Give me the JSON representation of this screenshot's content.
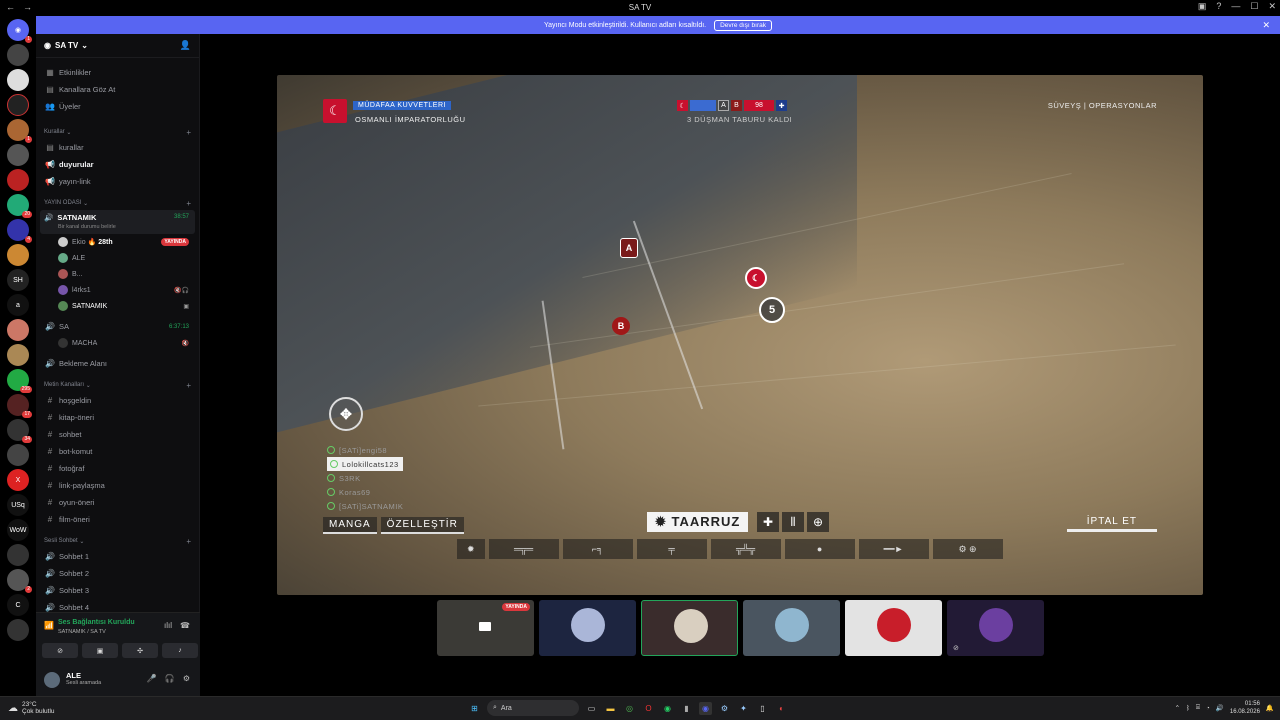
{
  "window": {
    "title": "SA TV"
  },
  "banner": {
    "text": "Yayıncı Modu etkinleştirildi. Kullanıcı adları kısaltıldı.",
    "button": "Devre dışı bırak"
  },
  "server": {
    "name": "SA TV",
    "links": [
      {
        "label": "Etkinlikler",
        "icon": "calendar-icon"
      },
      {
        "label": "Kanallara Göz At",
        "icon": "browse-icon"
      },
      {
        "label": "Üyeler",
        "icon": "members-icon"
      }
    ],
    "categories": {
      "kurallar": "Kurallar",
      "yayin": "YAYIN ODASI",
      "metin": "Metin Kanalları",
      "sesli": "Sesli Sohbet"
    },
    "rules_channels": [
      "kurallar",
      "duyurular",
      "yayın-link"
    ],
    "voice_channel_1": {
      "name": "SATNAMIK",
      "time": "38:57",
      "subtitle": "Bir kanal durumu belirle",
      "users": [
        {
          "name": "Ekio",
          "extra": "🔥 28th",
          "live": "YAYINDA"
        },
        {
          "name": "ALE"
        },
        {
          "name": "B..."
        },
        {
          "name": "l4rks1"
        },
        {
          "name": "SATNAMIK"
        }
      ]
    },
    "voice_channel_2": {
      "name": "SA",
      "time": "6:37:13",
      "users": [
        {
          "name": "MACHA"
        }
      ]
    },
    "waiting": "Bekleme Alanı",
    "text_channels": [
      "hoşgeldin",
      "kitap-öneri",
      "sohbet",
      "bot-komut",
      "fotoğraf",
      "link-paylaşma",
      "oyun-öneri",
      "film-öneri"
    ],
    "voice_channels": [
      "Sohbet 1",
      "Sohbet 2",
      "Sohbet 3",
      "Sohbet 4"
    ]
  },
  "voice_panel": {
    "status": "Ses Bağlantısı Kuruldu",
    "channel": "SATNAMIK / SA TV"
  },
  "user_panel": {
    "name": "ALE",
    "status": "Sesli aramada"
  },
  "game": {
    "faction_tag": "MÜDAFAA KUVVETLERI",
    "faction_name": "OSMANLI İMPARATORLUĞU",
    "score": {
      "a": "A",
      "b": "B",
      "count": "98"
    },
    "score_sub": "3 DÜŞMAN TABURU KALDI",
    "map_name": "SÜVEYŞ | OPERASYONLAR",
    "objectives": {
      "a": "A",
      "b": "B",
      "five": "5"
    },
    "squad": [
      "[SATi]engi58",
      "Lolokillcats123",
      "S3RK",
      "Koras69",
      "[SATi]SATNAMIK"
    ],
    "tab_squad": "MANGA",
    "tab_custom": "ÖZELLEŞTİR",
    "tab_attack": "TAARRUZ",
    "tab_cancel": "İPTAL ET"
  },
  "tiles": [
    {
      "live": "YAYINDA"
    },
    {},
    {},
    {},
    {},
    {}
  ],
  "taskbar": {
    "temp": "23°C",
    "weather": "Çok bulutlu",
    "search": "Ara",
    "time": "01:56",
    "date": "16.08.2026"
  }
}
